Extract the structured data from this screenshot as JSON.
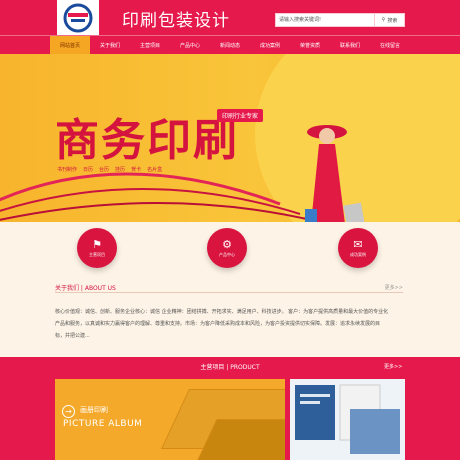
{
  "header": {
    "title": "印刷包装设计",
    "search_placeholder": "请输入搜索关键词!",
    "search_button": "搜索"
  },
  "nav": {
    "items": [
      "网站首页",
      "关于我们",
      "主营项目",
      "产品中心",
      "新闻动态",
      "成功案例",
      "荣誉资质",
      "联系我们",
      "在线留言"
    ]
  },
  "banner": {
    "title": "商务印刷",
    "tag": "印刷行业专家",
    "sub_items": [
      "书刊制作",
      "日历",
      "台历",
      "挂历",
      "贺卡",
      "名片盒"
    ]
  },
  "services": [
    {
      "label": "主营项目",
      "icon": "flag-icon"
    },
    {
      "label": "产品中心",
      "icon": "gear-icon"
    },
    {
      "label": "成功案例",
      "icon": "chat-icon"
    }
  ],
  "about": {
    "title": "关于我们 | ABOUT US",
    "more": "更多>>",
    "lines": [
      "核心价值观：诚信、创新、服务企业核心：诚信 企业精神：团结拼搏、开拓求实、满足用户、科技进步。 客户：为客户提供高质量和最大价值的专业化",
      "产品和服务，以真诚和实力赢得客户的理解、尊重和支持。市场：为客户降低采购成本和风险，为客户投资提供切实保障。发展：追求永续发展的目",
      "标，并把公建..."
    ]
  },
  "products": {
    "title": "主营项目 | PRODUCT",
    "more": "更多>>",
    "card_cn": "画册印刷",
    "card_en": "PICTURE ALBUM"
  }
}
